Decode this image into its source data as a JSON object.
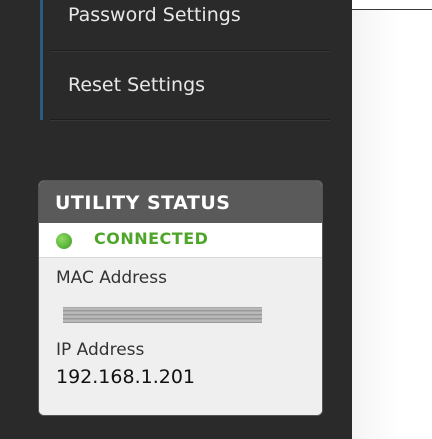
{
  "sidebar": {
    "items": [
      {
        "label": "Password Settings"
      },
      {
        "label": "Reset Settings"
      }
    ]
  },
  "utility_status": {
    "title": "UTILITY STATUS",
    "connection": {
      "status": "CONNECTED",
      "status_color": "#4fa52a"
    },
    "mac_address": {
      "label": "MAC Address",
      "value": "redacted"
    },
    "ip_address": {
      "label": "IP Address",
      "value": "192.168.1.201"
    }
  },
  "colors": {
    "sidebar_bg": "#2a2a2a",
    "panel_header_bg": "#5a5a5a",
    "nav_accent": "#2c5a80"
  }
}
